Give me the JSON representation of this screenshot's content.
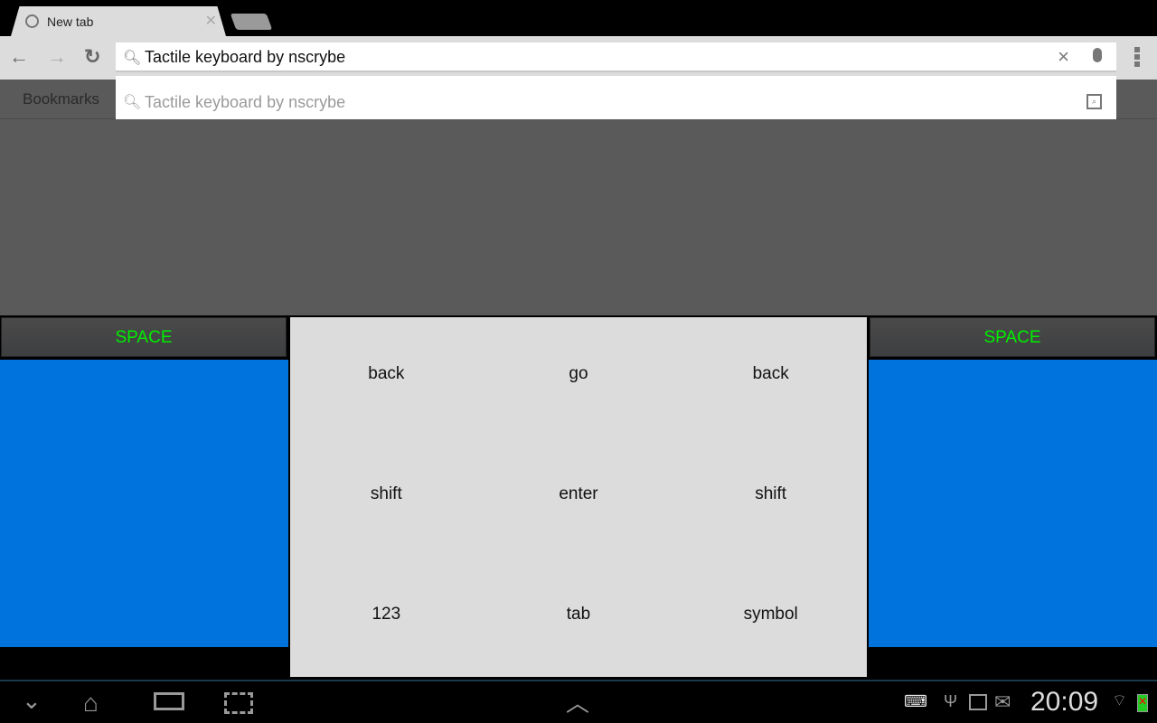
{
  "browser": {
    "tab_title": "New tab",
    "omnibox_value": "Tactile keyboard by nscrybe",
    "suggestion": "Tactile keyboard by nscrybe",
    "bookmarks_label": "Bookmarks"
  },
  "keyboard": {
    "left_space": "SPACE",
    "right_space": "SPACE",
    "keys": [
      "back",
      "go",
      "back",
      "shift",
      "enter",
      "shift",
      "123",
      "tab",
      "symbol"
    ],
    "colors": {
      "side_panel": "#0074dc",
      "space_text": "#00ee00",
      "center_bg": "#dcdcdc"
    }
  },
  "system": {
    "clock": "20:09",
    "icons": [
      "keyboard-icon",
      "usb-icon",
      "gallery-icon",
      "email-icon",
      "wifi-icon",
      "battery-icon"
    ]
  }
}
